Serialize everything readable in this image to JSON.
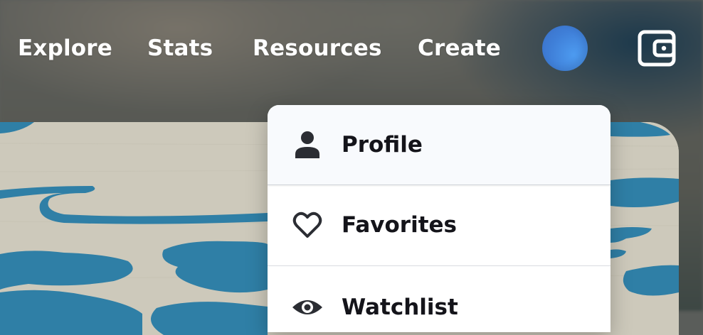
{
  "nav": {
    "items": [
      {
        "label": "Explore"
      },
      {
        "label": "Stats"
      },
      {
        "label": "Resources"
      },
      {
        "label": "Create"
      }
    ],
    "avatar_color": "#4488e6",
    "wallet_icon": "wallet-icon"
  },
  "menu": {
    "items": [
      {
        "label": "Profile",
        "icon": "person-icon",
        "active": true
      },
      {
        "label": "Favorites",
        "icon": "heart-icon",
        "active": false
      },
      {
        "label": "Watchlist",
        "icon": "eye-icon",
        "active": false
      }
    ]
  },
  "colors": {
    "menu_text": "#14141a",
    "active_bg": "#f8fafd",
    "art_blue": "#2f7fa6",
    "art_cream": "#cdc9bb"
  }
}
